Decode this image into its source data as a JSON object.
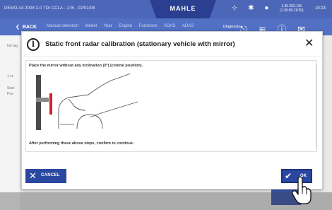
{
  "topbar": {
    "vehicle": "DEMO A4 2008 2.0 TDI CCLA - 176 - 02/01/08",
    "brand": "MAHLE",
    "coords_line1": "1.30.262.115",
    "coords_line2": "(1.30.80.11/20)",
    "time": "10:13",
    "icons": [
      "antenna-icon",
      "bluetooth-icon",
      "record-icon"
    ]
  },
  "navbar": {
    "back_label": "BACK",
    "breadcrumbs": [
      "Manual selection",
      "Model",
      "Year",
      "Engine",
      "Functions",
      "ADAS",
      "ADAS"
    ],
    "diagnosis_label": "Diagnosis",
    "icons": [
      "car-diagnosis-icon",
      "wifi-icon",
      "help-icon",
      "mail-icon",
      "menu-icon"
    ]
  },
  "background": {
    "left_labels": [
      "Init tag",
      "1 cc",
      "Start",
      "Pos"
    ]
  },
  "dialog": {
    "title": "Static front radar calibration (stationary vehicle with mirror)",
    "instruction": "Place the mirror without any inclination (0°) (central position).",
    "after_text": "After performing these above steps, confirm to continue.",
    "cancel_label": "CANCEL",
    "ok_label": "OK"
  },
  "colors": {
    "header_blue": "#4c66b8",
    "button_blue": "#2b48a0",
    "mirror_red": "#d4202a"
  }
}
